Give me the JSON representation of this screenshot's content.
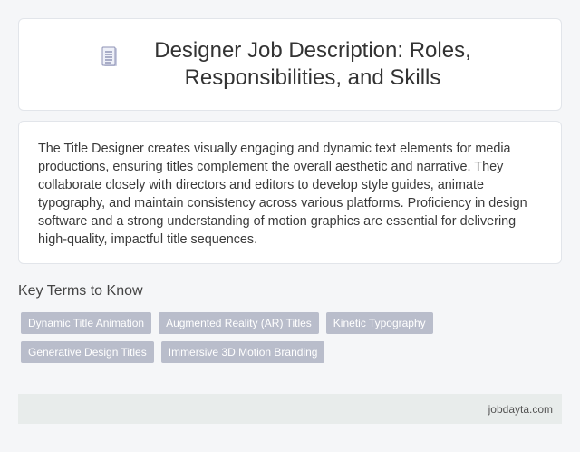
{
  "header": {
    "icon": "document-icon",
    "title": "Designer Job Description: Roles, Responsibilities, and Skills"
  },
  "description": {
    "text": "The Title Designer creates visually engaging and dynamic text elements for media productions, ensuring titles complement the overall aesthetic and narrative. They collaborate closely with directors and editors to develop style guides, animate typography, and maintain consistency across various platforms. Proficiency in design software and a strong understanding of motion graphics are essential for delivering high-quality, impactful title sequences."
  },
  "key_terms": {
    "heading": "Key Terms to Know",
    "tags": [
      "Dynamic Title Animation",
      "Augmented Reality (AR) Titles",
      "Kinetic Typography",
      "Generative Design Titles",
      "Immersive 3D Motion Branding"
    ]
  },
  "footer": {
    "source": "jobdayta.com"
  },
  "colors": {
    "tag_background": "#b9bdcb",
    "footer_background": "#e8eceb",
    "page_background": "#f5f6f8"
  }
}
